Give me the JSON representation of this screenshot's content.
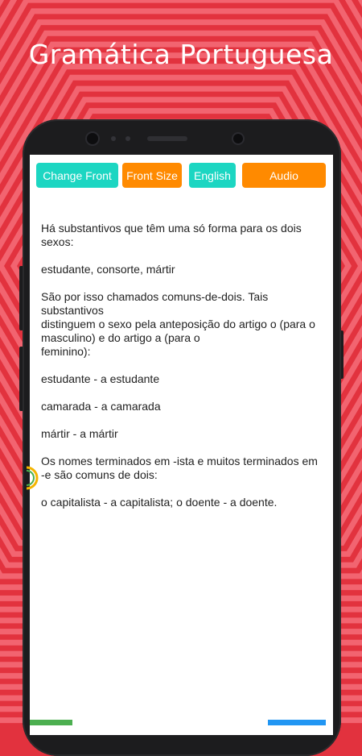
{
  "promo": {
    "headline": "Gramática Portuguesa"
  },
  "toolbar": {
    "change_front": "Change Front",
    "front_size": "Front Size",
    "english": "English",
    "audio": "Audio"
  },
  "lesson": {
    "paragraphs": [
      "Há substantivos que têm uma só forma para os dois sexos:",
      "estudante, consorte, mártir",
      "São por isso chamados comuns-de-dois. Tais substantivos\ndistinguem o sexo pela anteposição do artigo o (para o masculino) e do artigo a (para o\nfeminino):",
      "estudante - a estudante",
      "camarada - a camarada",
      "mártir - a mártir",
      "Os nomes terminados em -ista e muitos terminados em -e são comuns de dois:",
      "o capitalista - a capitalista; o doente - a doente."
    ]
  },
  "colors": {
    "background": "#e2323e",
    "teal_button": "#1cd6c2",
    "orange_button": "#ff8a00"
  }
}
